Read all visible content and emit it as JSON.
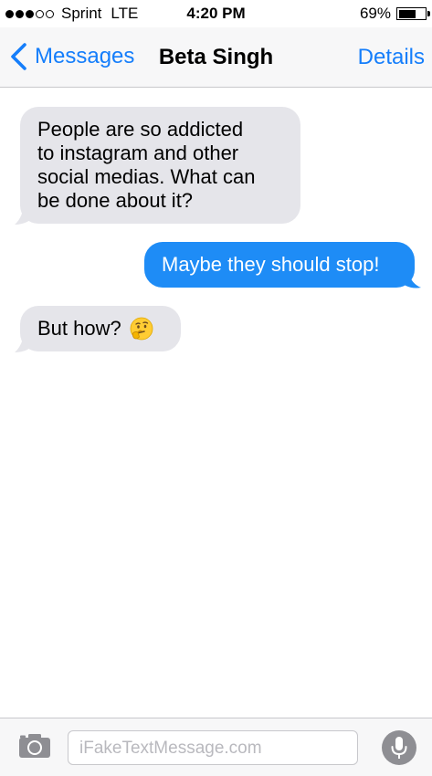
{
  "status_bar": {
    "signal_dots_filled": 3,
    "signal_dots_total": 5,
    "carrier": "Sprint",
    "network": "LTE",
    "time": "4:20 PM",
    "battery_percent": "69%",
    "battery_level": 0.69
  },
  "nav": {
    "back_label": "Messages",
    "title": "Beta Singh",
    "details_label": "Details"
  },
  "messages": [
    {
      "direction": "incoming",
      "lines": [
        "People are so addicted",
        "to instagram and other",
        "social medias. What can",
        "be done about it?"
      ]
    },
    {
      "direction": "outgoing",
      "lines": [
        "Maybe they should stop!"
      ]
    },
    {
      "direction": "incoming",
      "lines": [
        "But how?"
      ],
      "emoji": "🤔"
    }
  ],
  "input": {
    "placeholder": "iFakeTextMessage.com"
  },
  "colors": {
    "accent": "#157efb",
    "outgoing_bubble": "#1e8cf6",
    "incoming_bubble": "#e5e5ea",
    "bar_background": "#f7f7f8"
  },
  "icons": {
    "back": "chevron-left-icon",
    "camera": "camera-icon",
    "mic": "microphone-icon",
    "emoji": "thinking-face-emoji"
  }
}
